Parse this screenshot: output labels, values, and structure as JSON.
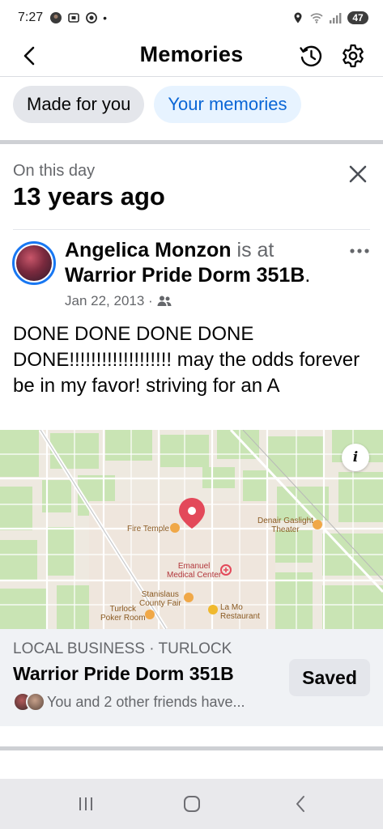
{
  "status_bar": {
    "time": "7:27",
    "dot": "•",
    "battery": "47",
    "icons_left": [
      "avatar-notification-icon",
      "screenshot-icon",
      "record-icon"
    ],
    "icons_right": [
      "location-icon",
      "wifi-icon",
      "signal-icon",
      "battery-icon"
    ]
  },
  "header": {
    "title": "Memories",
    "icons": [
      "back-arrow-icon",
      "history-clock-icon",
      "settings-gear-icon"
    ]
  },
  "filters": {
    "made_for_you": "Made for you",
    "your_memories": "Your memories",
    "active": "Made for you"
  },
  "memory": {
    "label": "On this day",
    "years_ago": "13 years ago",
    "close_icon": "close-icon"
  },
  "post": {
    "author": "Angelica Monzon",
    "is_at": " is at ",
    "place": "Warrior Pride Dorm 351B",
    "period": ".",
    "date": "Jan 22, 2013 ·",
    "audience_icon": "friends-icon",
    "more_icon": "more-dots-icon",
    "text": "DONE DONE DONE DONE DONE!!!!!!!!!!!!!!!!!!! may the odds forever be in my favor! striving for an A"
  },
  "map": {
    "info_label": "i",
    "labels": {
      "fire_temple": "Fire Temple",
      "denair": "Denair Gaslight\nTheater",
      "emanuel": "Emanuel\nMedical Center",
      "stanislaus": "Stanislaus\nCounty Fair",
      "lamo": "La Mo\nRestaurant",
      "turlock_poker": "Turlock\nPoker Room"
    },
    "colors": {
      "pin": "#e3495a",
      "greenery": "#c9e4b4",
      "roads": "#ffffff",
      "poi_orange": "#f0a848"
    }
  },
  "business": {
    "category": "LOCAL BUSINESS · TURLOCK",
    "name": "Warrior Pride Dorm 351B",
    "friends_text": "You and 2 other friends have...",
    "saved_label": "Saved"
  },
  "nav_bar": {
    "icons": [
      "recent-apps-icon",
      "home-icon",
      "back-icon"
    ]
  },
  "colors": {
    "accent": "#0a66d6",
    "pill_active_bg": "#e4e6eb",
    "pill_inactive_bg": "#e7f3ff",
    "business_bg": "#f0f2f5"
  }
}
